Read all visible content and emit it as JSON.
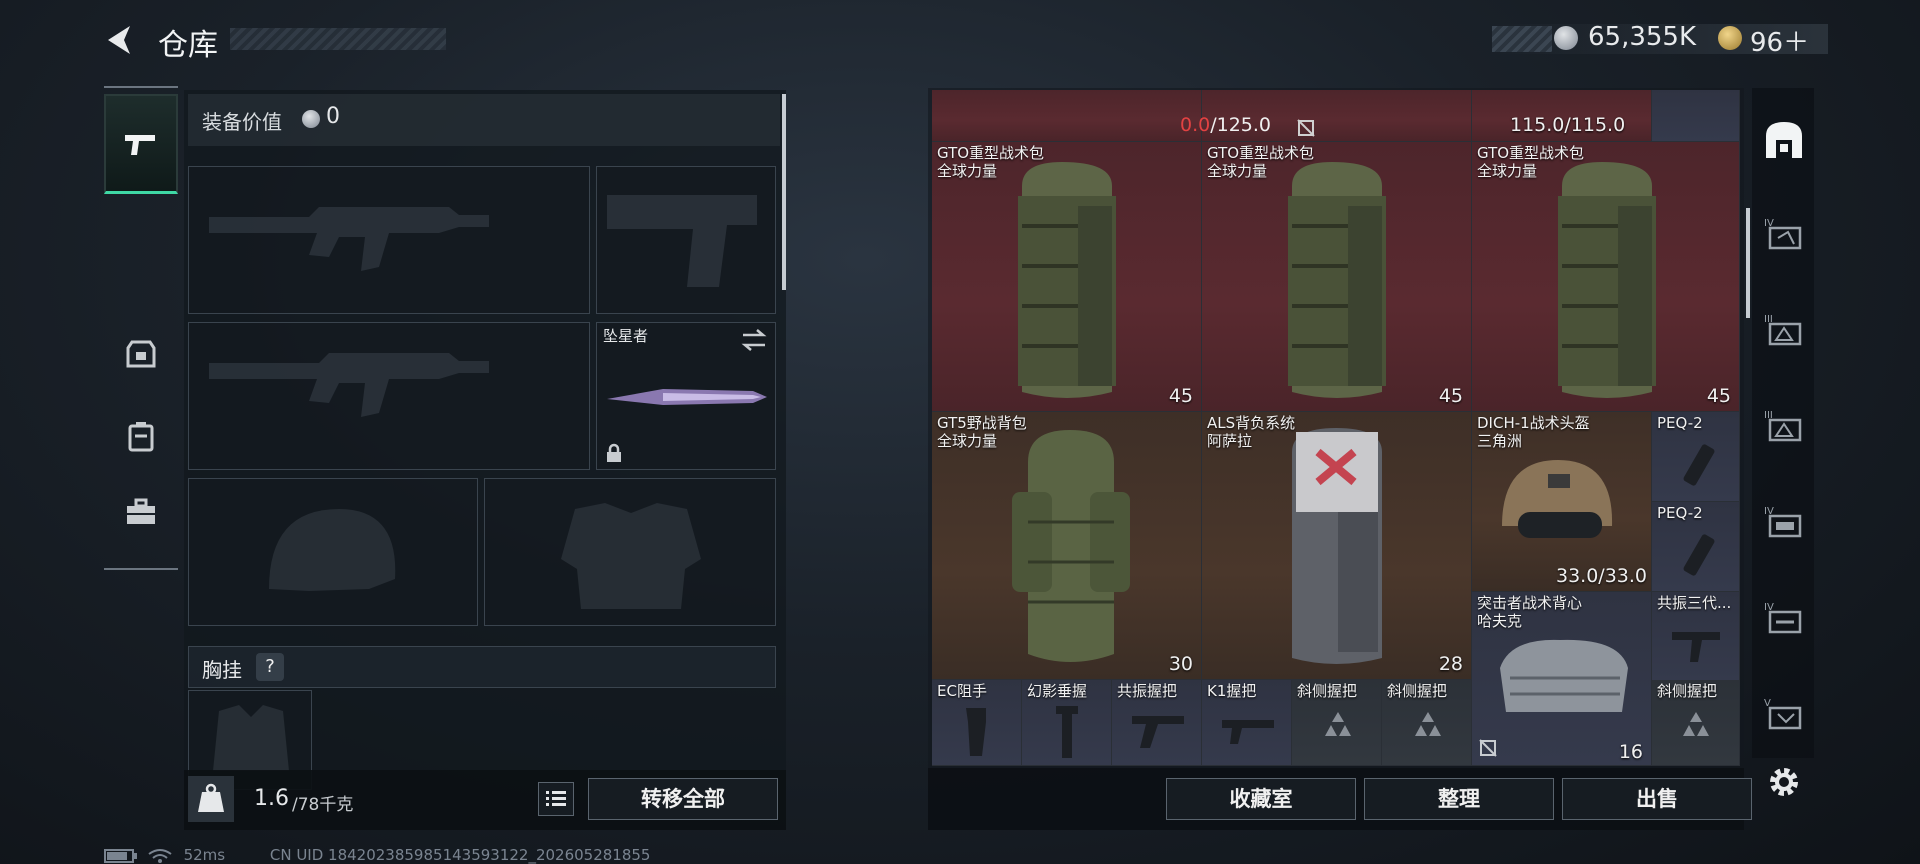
{
  "header": {
    "title": "仓库"
  },
  "currency": {
    "silver": "65,355K",
    "gold": "96＋"
  },
  "loadout": {
    "equip_value_label": "装备价值",
    "equip_value": "0",
    "melee_label": "坠星者",
    "chest_label": "胸挂",
    "chest_help": "?"
  },
  "weight": {
    "value": "1.6",
    "unit": "/78千克"
  },
  "buttons": {
    "transfer_all": "转移全部",
    "collection": "收藏室",
    "organize": "整理",
    "sell": "出售"
  },
  "inventory": {
    "top_row": {
      "left_current": "0.0",
      "left_max": "/125.0",
      "right_value": "115.0/115.0"
    },
    "items": [
      {
        "name": "GTO重型战术包",
        "source": "全球力量",
        "count": "45"
      },
      {
        "name": "GTO重型战术包",
        "source": "全球力量",
        "count": "45"
      },
      {
        "name": "GTO重型战术包",
        "source": "全球力量",
        "count": "45"
      },
      {
        "name": "GT5野战背包",
        "source": "全球力量",
        "count": "30"
      },
      {
        "name": "ALS背负系统",
        "source": "阿萨拉",
        "count": "28"
      },
      {
        "name": "DICH-1战术头盔",
        "source": "三角洲",
        "durability": "33.0/33.0"
      },
      {
        "name": "PEQ-2"
      },
      {
        "name": "PEQ-2"
      },
      {
        "name": "突击者战术背心",
        "source": "哈夫克",
        "count": "16"
      },
      {
        "name": "共振三代..."
      },
      {
        "name": "EC阻手"
      },
      {
        "name": "幻影垂握"
      },
      {
        "name": "共振握把"
      },
      {
        "name": "K1握把"
      },
      {
        "name": "斜侧握把"
      },
      {
        "name": "斜侧握把"
      },
      {
        "name": "斜侧握把"
      }
    ]
  },
  "sidebar": {
    "icons": [
      "arch-icon",
      "attachment-iv-icon",
      "attachment-iii-icon",
      "attachment-iii-icon",
      "attachment-iv-icon",
      "attachment-iv-icon",
      "attachment-v-icon"
    ]
  },
  "status": {
    "ping": "52ms",
    "uid": "CN UID 1842023859851435931​22_202605281855"
  },
  "colors": {
    "accent": "#3fd8a5",
    "rare_red": "#5a2a30",
    "epic_brown": "#4a372b",
    "purple": "#353a4c",
    "warning_red": "#e24242"
  }
}
